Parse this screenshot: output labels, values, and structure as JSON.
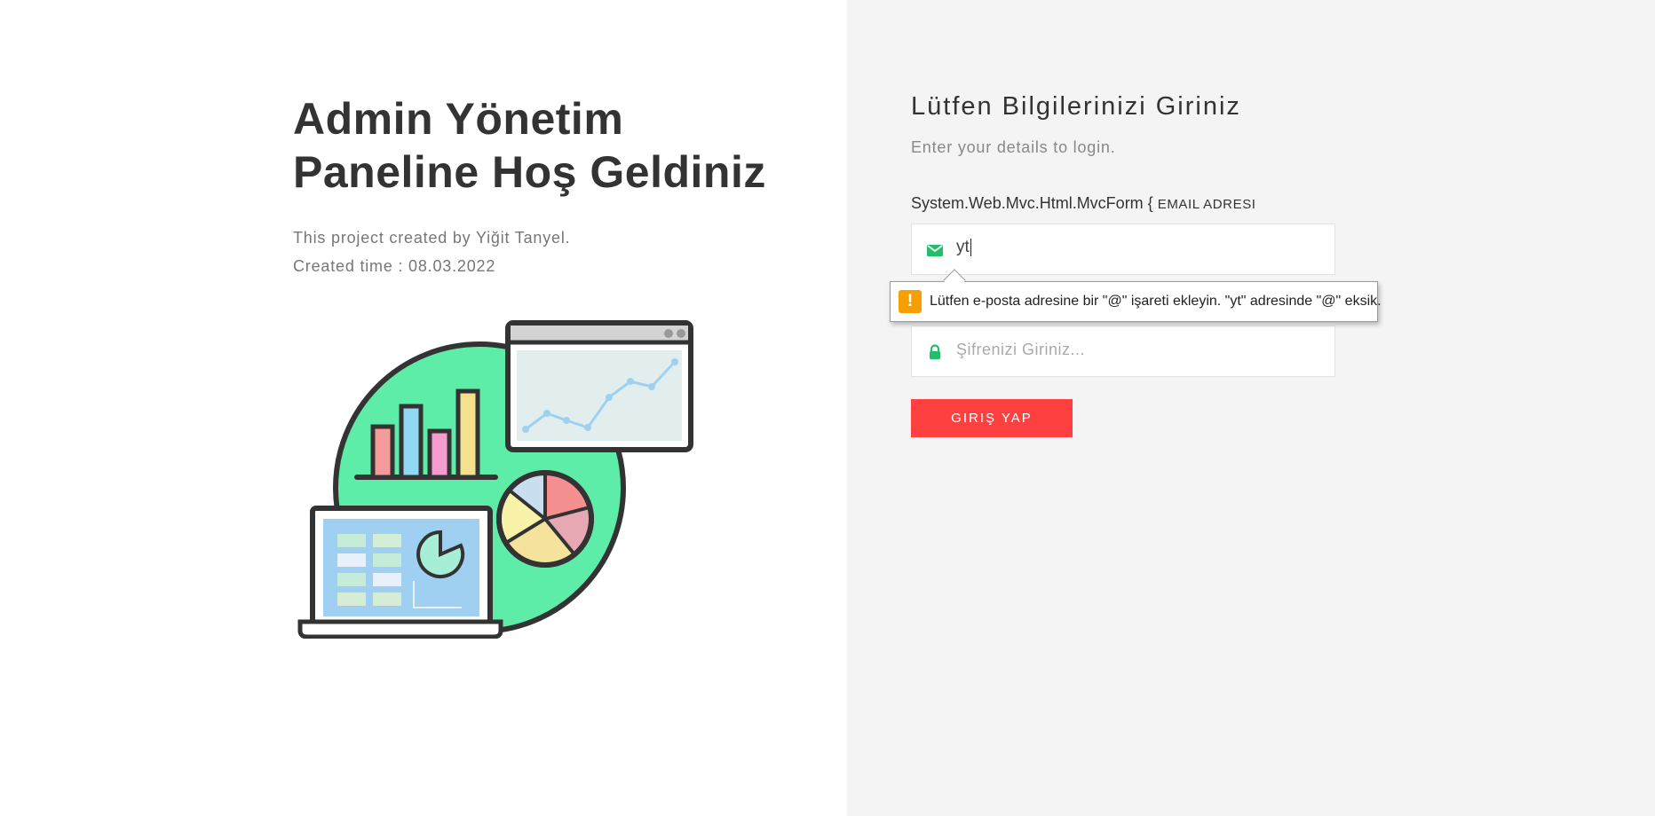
{
  "welcome": {
    "title_line1": "Admin Yönetim",
    "title_line2": "Paneline Hoş Geldiniz",
    "created_by": "This project created by Yiğit Tanyel.",
    "created_time": "Created time : 08.03.2022"
  },
  "form": {
    "title": "Lütfen Bilgilerinizi Giriniz",
    "subtitle": "Enter your details to login.",
    "label_prefix": "System.Web.Mvc.Html.MvcForm {",
    "email_label": "EMAIL ADRESI",
    "email": {
      "value": "yt",
      "icon": "envelope-icon"
    },
    "password": {
      "placeholder": "Şifrenizi Giriniz...",
      "icon": "lock-icon"
    },
    "validation_tooltip": {
      "icon": "warning-icon",
      "icon_glyph": "!",
      "message": "Lütfen e-posta adresine bir \"@\" işareti ekleyin. \"yt\" adresinde \"@\" eksik."
    },
    "submit_label": "GIRIŞ YAP"
  },
  "colors": {
    "accent": "#ff4040",
    "icon_green": "#1fbf6b",
    "warning": "#f5a000",
    "right_panel_bg": "#f4f4f4",
    "illustration_circle": "#5eeda8"
  }
}
